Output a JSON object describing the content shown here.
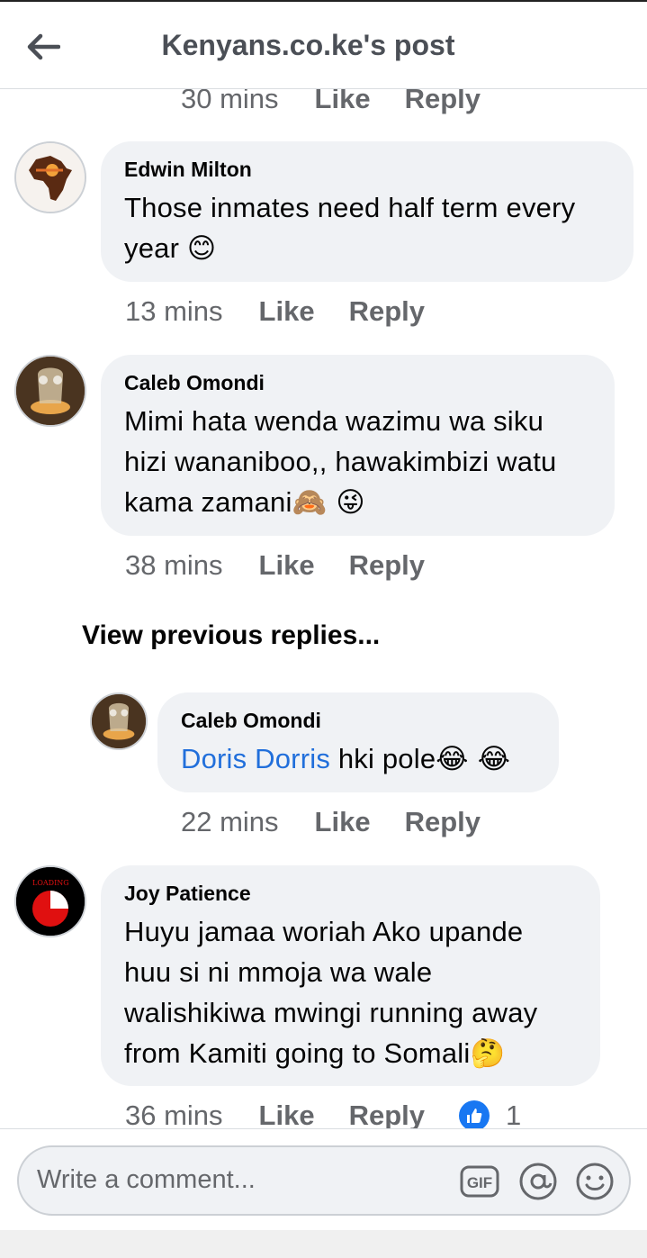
{
  "header": {
    "title": "Kenyans.co.ke's post"
  },
  "top_meta": {
    "time": "30 mins",
    "like": "Like",
    "reply": "Reply"
  },
  "comments": [
    {
      "author": "Edwin Milton",
      "text": "Those inmates need half term every year ",
      "emojis": "😊",
      "time": "13 mins",
      "like": "Like",
      "reply": "Reply"
    },
    {
      "author": "Caleb Omondi",
      "text": "Mimi hata wenda wazimu wa siku hizi wananiboo,, hawakimbizi watu kama zamani",
      "emojis": "🙈 😜",
      "time": "38 mins",
      "like": "Like",
      "reply": "Reply"
    }
  ],
  "view_previous": "View previous replies...",
  "reply": {
    "author": "Caleb Omondi",
    "mention": "Doris Dorris",
    "text": " hki pole",
    "emojis": "😂 😂",
    "time": "22 mins",
    "like": "Like",
    "reply": "Reply"
  },
  "last_comment": {
    "author": "Joy Patience",
    "avatar_text": "LOADING",
    "text": "Huyu jamaa woriah Ako upande huu si ni mmoja wa wale walishikiwa mwingi running away from Kamiti going to Somali",
    "emojis": "🤔",
    "time": "36 mins",
    "like": "Like",
    "reply": "Reply",
    "like_count": "1"
  },
  "composer": {
    "placeholder": "Write a comment...",
    "gif_label": "GIF"
  },
  "colors": {
    "accent": "#1877f2",
    "mention": "#216fdb",
    "bubble": "#f0f2f5",
    "muted": "#65676b"
  }
}
